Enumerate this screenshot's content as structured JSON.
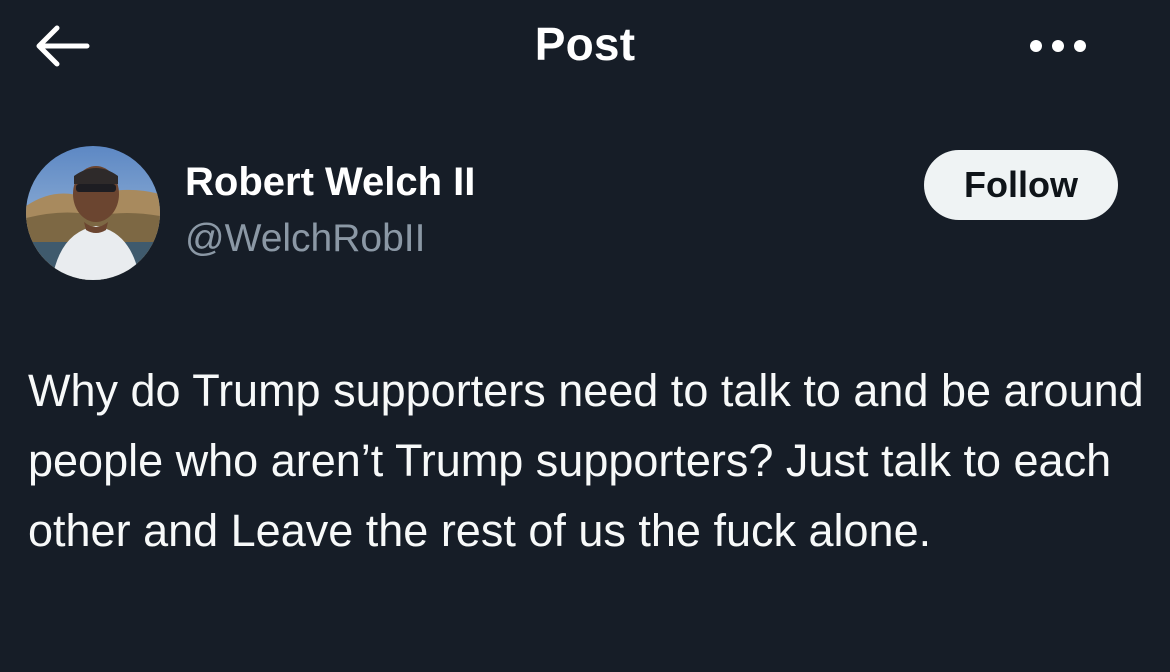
{
  "header": {
    "title": "Post",
    "back_icon": "arrow-left-icon",
    "more_icon": "more-horizontal-icon"
  },
  "post": {
    "author": {
      "name": "Robert Welch II",
      "handle": "@WelchRobII"
    },
    "follow_label": "Follow",
    "text": "Why do Trump supporters need to talk to and be around people who aren’t Trump supporters? Just talk to each other and Leave the rest of us the fuck alone."
  },
  "colors": {
    "background": "#161d27",
    "text_primary": "#f7f9f9",
    "text_secondary": "#8b98a5",
    "follow_bg": "#eff3f4",
    "follow_text": "#0f1419"
  }
}
